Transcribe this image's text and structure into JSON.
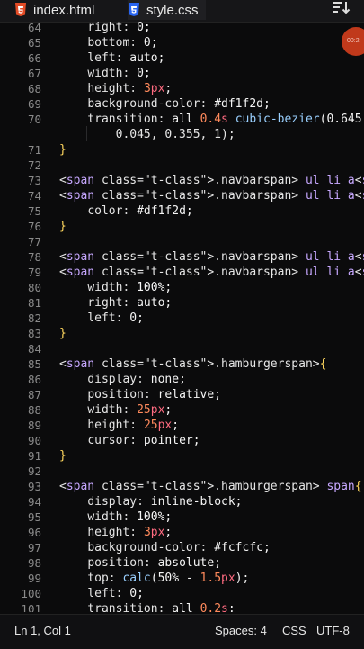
{
  "tabs": [
    {
      "label": "index.html",
      "icon": "html5-icon",
      "color": "#e34c26"
    },
    {
      "label": "style.css",
      "icon": "css3-icon",
      "color": "#2965f1",
      "active": true
    }
  ],
  "sort_icon": "sort-lines-icon",
  "timer": {
    "label": "00:2"
  },
  "code_lines": [
    {
      "n": "64",
      "text": "    right: 0;"
    },
    {
      "n": "65",
      "text": "    bottom: 0;"
    },
    {
      "n": "66",
      "text": "    left: auto;"
    },
    {
      "n": "67",
      "text": "    width: 0;"
    },
    {
      "n": "68",
      "text": "    height: 3px;"
    },
    {
      "n": "69",
      "text": "    background-color: #df1f2d;"
    },
    {
      "n": "70",
      "text": "    transition: all 0.4s cubic-bezier(0.645,"
    },
    {
      "n": "",
      "text": "        0.045, 0.355, 1);"
    },
    {
      "n": "71",
      "text": "}"
    },
    {
      "n": "72",
      "text": ""
    },
    {
      "n": "73",
      "text": ".navbar ul li a:hover,"
    },
    {
      "n": "74",
      "text": ".navbar ul li a.active{"
    },
    {
      "n": "75",
      "text": "    color: #df1f2d;"
    },
    {
      "n": "76",
      "text": "}"
    },
    {
      "n": "77",
      "text": ""
    },
    {
      "n": "78",
      "text": ".navbar ul li a:hover::after,"
    },
    {
      "n": "79",
      "text": ".navbar ul li a.active::after{"
    },
    {
      "n": "80",
      "text": "    width: 100%;"
    },
    {
      "n": "81",
      "text": "    right: auto;"
    },
    {
      "n": "82",
      "text": "    left: 0;"
    },
    {
      "n": "83",
      "text": "}"
    },
    {
      "n": "84",
      "text": ""
    },
    {
      "n": "85",
      "text": ".hamburger{"
    },
    {
      "n": "86",
      "text": "    display: none;"
    },
    {
      "n": "87",
      "text": "    position: relative;"
    },
    {
      "n": "88",
      "text": "    width: 25px;"
    },
    {
      "n": "89",
      "text": "    height: 25px;"
    },
    {
      "n": "90",
      "text": "    cursor: pointer;"
    },
    {
      "n": "91",
      "text": "}"
    },
    {
      "n": "92",
      "text": ""
    },
    {
      "n": "93",
      "text": ".hamburger span{"
    },
    {
      "n": "94",
      "text": "    display: inline-block;"
    },
    {
      "n": "95",
      "text": "    width: 100%;"
    },
    {
      "n": "96",
      "text": "    height: 3px;"
    },
    {
      "n": "97",
      "text": "    background-color: #fcfcfc;"
    },
    {
      "n": "98",
      "text": "    position: absolute;"
    },
    {
      "n": "99",
      "text": "    top: calc(50% - 1.5px);"
    },
    {
      "n": "100",
      "text": "    left: 0;"
    },
    {
      "n": "101",
      "text": "    transition: all 0.2s;"
    }
  ],
  "status": {
    "position": "Ln 1, Col 1",
    "spaces": "Spaces: 4",
    "language": "CSS",
    "encoding": "UTF-8"
  }
}
